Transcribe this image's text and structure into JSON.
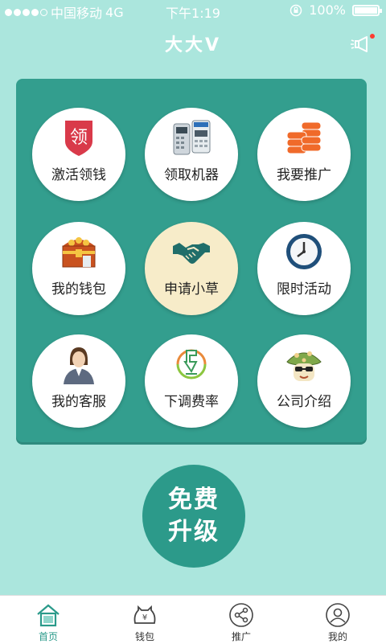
{
  "status_bar": {
    "carrier": "中国移动",
    "network": "4G",
    "time": "下午1:19",
    "battery": "100%"
  },
  "header": {
    "title": "大大V"
  },
  "grid": [
    {
      "label": "激活领钱",
      "icon": "activate-icon"
    },
    {
      "label": "领取机器",
      "icon": "pos-machine-icon"
    },
    {
      "label": "我要推广",
      "icon": "coins-icon"
    },
    {
      "label": "我的钱包",
      "icon": "treasure-chest-icon"
    },
    {
      "label": "申请小草",
      "icon": "handshake-icon"
    },
    {
      "label": "限时活动",
      "icon": "clock-icon"
    },
    {
      "label": "我的客服",
      "icon": "customer-service-icon"
    },
    {
      "label": "下调费率",
      "icon": "rate-down-icon"
    },
    {
      "label": "公司介绍",
      "icon": "mushroom-icon"
    }
  ],
  "activate_badge": "领",
  "upgrade": {
    "line1": "免费",
    "line2": "升级"
  },
  "tabs": [
    {
      "label": "首页",
      "icon": "home-icon"
    },
    {
      "label": "钱包",
      "icon": "wallet-icon"
    },
    {
      "label": "推广",
      "icon": "share-icon"
    },
    {
      "label": "我的",
      "icon": "profile-icon"
    }
  ],
  "colors": {
    "background": "#abe6dd",
    "panel": "#339e8e",
    "accent": "#2a9a8a"
  }
}
